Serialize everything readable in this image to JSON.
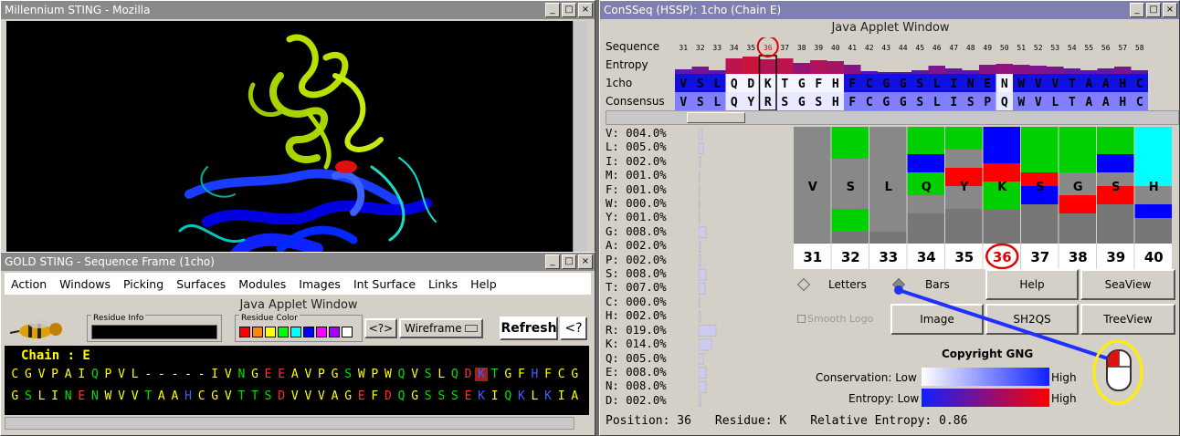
{
  "win1": {
    "title": "Millennium STING - Mozilla"
  },
  "win2": {
    "title": "GOLD STING - Sequence Frame (1cho)",
    "menu": [
      "Action",
      "Windows",
      "Picking",
      "Surfaces",
      "Modules",
      "Images",
      "Int Surface",
      "Links",
      "Help"
    ],
    "applet_title": "Java Applet Window",
    "residue_info_label": "Residue Info",
    "residue_color_label": "Residue Color",
    "swatches": [
      "#ff0000",
      "#ff8800",
      "#ffff00",
      "#00ff00",
      "#00ffff",
      "#0000ff",
      "#ff00ff",
      "#aa00ff",
      "#ffffff"
    ],
    "nav_btn": "<?>",
    "wireframe": "Wireframe",
    "refresh": "Refresh",
    "help": "<?",
    "chain": "Chain : E",
    "seq1": "CGVPAIQPVL-----IVNGEEAVPGSWPWQVSLQDKTGFHFCG",
    "seq2": "GSLINENWVVTAAHCGVTTSDVVVAGEFDQGSSSEKIQKLKIA"
  },
  "win3": {
    "title": "ConSSeq (HSSP): 1cho (Chain E)",
    "applet_title": "Java Applet Window",
    "row_labels": [
      "Sequence",
      "Entropy",
      "1cho",
      "Consensus"
    ],
    "positions": [
      "31",
      "32",
      "33",
      "34",
      "35",
      "36",
      "37",
      "38",
      "39",
      "40",
      "41",
      "42",
      "43",
      "44",
      "45",
      "46",
      "47",
      "48",
      "49",
      "50",
      "51",
      "52",
      "53",
      "54",
      "55",
      "56",
      "57",
      "58"
    ],
    "entropy": [
      0.25,
      0.4,
      0.2,
      0.85,
      0.95,
      0.8,
      0.85,
      0.6,
      0.75,
      0.7,
      0.5,
      0.15,
      0.1,
      0.1,
      0.2,
      0.45,
      0.3,
      0.2,
      0.5,
      0.55,
      0.5,
      0.45,
      0.4,
      0.3,
      0.2,
      0.3,
      0.4,
      0.2
    ],
    "seq_1cho": "VSLQDKTGFHFCGGSLINENWVVTAAHC",
    "consensus": "VSLQYRSGSHFCGGSLISPQWVLTAAHC",
    "freqs": [
      "V: 004.0%",
      "L: 005.0%",
      "I: 002.0%",
      "M: 001.0%",
      "F: 001.0%",
      "W: 000.0%",
      "Y: 001.0%",
      "G: 008.0%",
      "A: 002.0%",
      "P: 002.0%",
      "S: 008.0%",
      "T: 007.0%",
      "C: 000.0%",
      "H: 002.0%",
      "R: 019.0%",
      "K: 014.0%",
      "Q: 005.0%",
      "E: 008.0%",
      "N: 008.0%",
      "D: 002.0%"
    ],
    "freq_values": [
      4,
      5,
      2,
      1,
      1,
      0,
      1,
      8,
      2,
      2,
      8,
      7,
      0,
      2,
      19,
      14,
      5,
      8,
      8,
      2
    ],
    "logo_positions": [
      "31",
      "32",
      "33",
      "34",
      "35",
      "36",
      "37",
      "38",
      "39",
      "40"
    ],
    "logo_letters": [
      "V",
      "S",
      "L",
      "Q",
      "Y",
      "K",
      "S",
      "G",
      "S",
      "H"
    ],
    "mode_letters": "Letters",
    "mode_bars": "Bars",
    "btn_help": "Help",
    "btn_seaview": "SeaView",
    "smooth_logo": "Smooth Logo",
    "btn_image": "Image",
    "btn_sh2qs": "SH2QS",
    "btn_treeview": "TreeView",
    "copyright": "Copyright GNG",
    "conservation_label": "Conservation: Low",
    "entropy_label": "Entropy: Low",
    "high": "High",
    "status_position": "Position: 36",
    "status_residue": "Residue: K",
    "status_entropy": "Relative Entropy: 0.86"
  }
}
